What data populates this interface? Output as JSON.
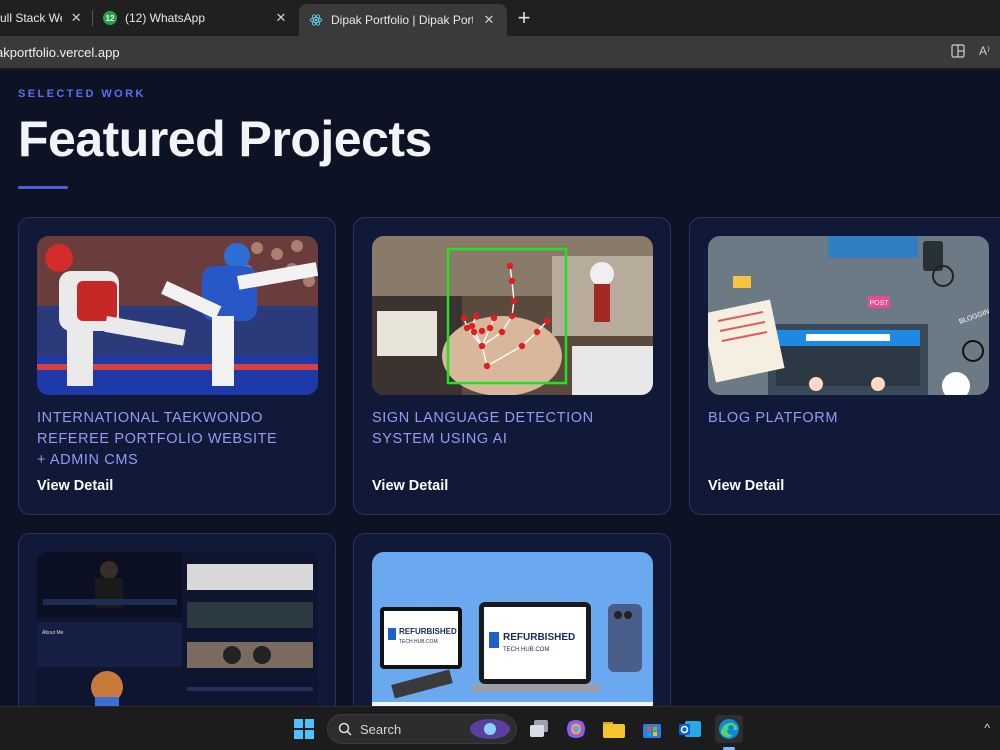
{
  "browser": {
    "tabs": [
      {
        "title": "ull Stack Web D",
        "close": "✕"
      },
      {
        "title": "(12) WhatsApp",
        "badge": "12",
        "close": "✕"
      },
      {
        "title": "Dipak Portfolio | Dipak Portfolio",
        "close": "✕"
      }
    ],
    "new_tab": "+",
    "url": "akportfolio.vercel.app",
    "read_aloud": "A⁾"
  },
  "page": {
    "eyebrow": "SELECTED WORK",
    "heading": "Featured Projects",
    "accent": "#5160d8",
    "projects": [
      {
        "title": "INTERNATIONAL TAEKWONDO REFEREE PORTFOLIO WEBSITE + ADMIN CMS",
        "link": "View Detail"
      },
      {
        "title": "SIGN LANGUAGE DETECTION SYSTEM USING AI",
        "link": "View Detail"
      },
      {
        "title": "BLOG PLATFORM",
        "link": "View Detail"
      },
      {
        "title": "",
        "link": ""
      },
      {
        "title": "",
        "link": ""
      }
    ],
    "thumb_text": {
      "refurbished_1": "REFURBISHED",
      "refurbished_2": "TECH HUB.COM",
      "blogging": "BLOGGING",
      "post": "POST",
      "about": "About Me"
    }
  },
  "taskbar": {
    "search_label": "Search",
    "up_arrow": "^"
  }
}
